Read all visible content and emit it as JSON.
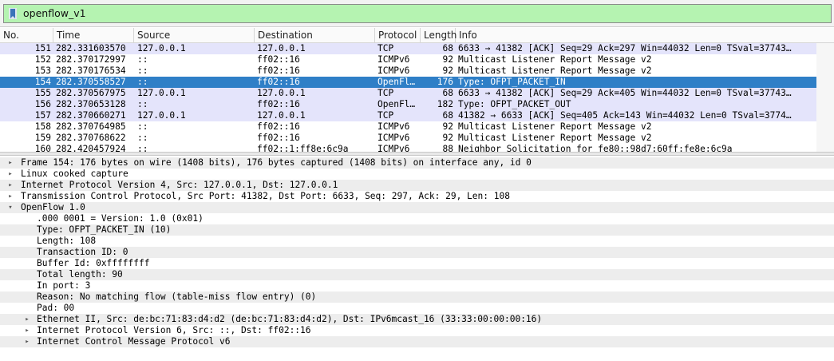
{
  "filter": {
    "icon": "bookmark-icon",
    "value": "openflow_v1"
  },
  "columns": {
    "no": "No.",
    "time": "Time",
    "source": "Source",
    "destination": "Destination",
    "protocol": "Protocol",
    "length": "Length",
    "info": "Info"
  },
  "packets": [
    {
      "no": "151",
      "time": "282.331603570",
      "source": "127.0.0.1",
      "destination": "127.0.0.1",
      "protocol": "TCP",
      "length": "68",
      "info": "6633 → 41382 [ACK] Seq=29 Ack=297 Win=44032 Len=0 TSval=37743…",
      "style": "tcp"
    },
    {
      "no": "152",
      "time": "282.370172997",
      "source": "::",
      "destination": "ff02::16",
      "protocol": "ICMPv6",
      "length": "92",
      "info": "Multicast Listener Report Message v2",
      "style": "icmp"
    },
    {
      "no": "153",
      "time": "282.370176534",
      "source": "::",
      "destination": "ff02::16",
      "protocol": "ICMPv6",
      "length": "92",
      "info": "Multicast Listener Report Message v2",
      "style": "icmp"
    },
    {
      "no": "154",
      "time": "282.370558527",
      "source": "::",
      "destination": "ff02::16",
      "protocol": "OpenFl…",
      "length": "176",
      "info": "Type: OFPT_PACKET_IN",
      "style": "sel"
    },
    {
      "no": "155",
      "time": "282.370567975",
      "source": "127.0.0.1",
      "destination": "127.0.0.1",
      "protocol": "TCP",
      "length": "68",
      "info": "6633 → 41382 [ACK] Seq=29 Ack=405 Win=44032 Len=0 TSval=37743…",
      "style": "tcp"
    },
    {
      "no": "156",
      "time": "282.370653128",
      "source": "::",
      "destination": "ff02::16",
      "protocol": "OpenFl…",
      "length": "182",
      "info": "Type: OFPT_PACKET_OUT",
      "style": "tcp"
    },
    {
      "no": "157",
      "time": "282.370660271",
      "source": "127.0.0.1",
      "destination": "127.0.0.1",
      "protocol": "TCP",
      "length": "68",
      "info": "41382 → 6633 [ACK] Seq=405 Ack=143 Win=44032 Len=0 TSval=3774…",
      "style": "tcp"
    },
    {
      "no": "158",
      "time": "282.370764985",
      "source": "::",
      "destination": "ff02::16",
      "protocol": "ICMPv6",
      "length": "92",
      "info": "Multicast Listener Report Message v2",
      "style": "icmp"
    },
    {
      "no": "159",
      "time": "282.370768622",
      "source": "::",
      "destination": "ff02::16",
      "protocol": "ICMPv6",
      "length": "92",
      "info": "Multicast Listener Report Message v2",
      "style": "icmp"
    },
    {
      "no": "160",
      "time": "282.420457924",
      "source": "::",
      "destination": "ff02::1:ff8e:6c9a",
      "protocol": "ICMPv6",
      "length": "88",
      "info": "Neighbor Solicitation for fe80::98d7:60ff:fe8e:6c9a",
      "style": "icmp"
    }
  ],
  "details": [
    {
      "text": "Frame 154: 176 bytes on wire (1408 bits), 176 bytes captured (1408 bits) on interface any, id 0",
      "level": 0,
      "arrow": "collapsed",
      "grey": true
    },
    {
      "text": "Linux cooked capture",
      "level": 0,
      "arrow": "collapsed",
      "grey": false
    },
    {
      "text": "Internet Protocol Version 4, Src: 127.0.0.1, Dst: 127.0.0.1",
      "level": 0,
      "arrow": "collapsed",
      "grey": true
    },
    {
      "text": "Transmission Control Protocol, Src Port: 41382, Dst Port: 6633, Seq: 297, Ack: 29, Len: 108",
      "level": 0,
      "arrow": "collapsed",
      "grey": false
    },
    {
      "text": "OpenFlow 1.0",
      "level": 0,
      "arrow": "expanded",
      "grey": true
    },
    {
      "text": ".000 0001 = Version: 1.0 (0x01)",
      "level": 1,
      "arrow": "none",
      "grey": false
    },
    {
      "text": "Type: OFPT_PACKET_IN (10)",
      "level": 1,
      "arrow": "none",
      "grey": true
    },
    {
      "text": "Length: 108",
      "level": 1,
      "arrow": "none",
      "grey": false
    },
    {
      "text": "Transaction ID: 0",
      "level": 1,
      "arrow": "none",
      "grey": true
    },
    {
      "text": "Buffer Id: 0xffffffff",
      "level": 1,
      "arrow": "none",
      "grey": false
    },
    {
      "text": "Total length: 90",
      "level": 1,
      "arrow": "none",
      "grey": true
    },
    {
      "text": "In port: 3",
      "level": 1,
      "arrow": "none",
      "grey": false
    },
    {
      "text": "Reason: No matching flow (table-miss flow entry) (0)",
      "level": 1,
      "arrow": "none",
      "grey": true
    },
    {
      "text": "Pad: 00",
      "level": 1,
      "arrow": "none",
      "grey": false
    },
    {
      "text": "Ethernet II, Src: de:bc:71:83:d4:d2 (de:bc:71:83:d4:d2), Dst: IPv6mcast_16 (33:33:00:00:00:16)",
      "level": 1,
      "arrow": "collapsed",
      "grey": true
    },
    {
      "text": "Internet Protocol Version 6, Src: ::, Dst: ff02::16",
      "level": 1,
      "arrow": "collapsed",
      "grey": false
    },
    {
      "text": "Internet Control Message Protocol v6",
      "level": 1,
      "arrow": "collapsed",
      "grey": true
    }
  ]
}
